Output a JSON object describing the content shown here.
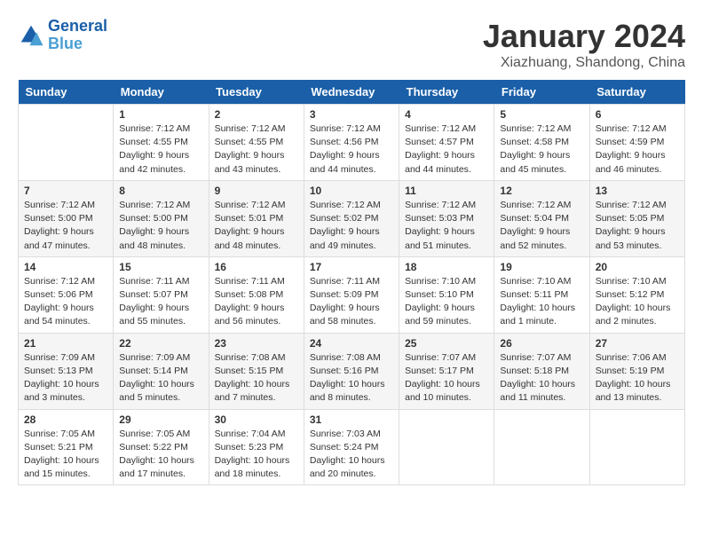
{
  "header": {
    "logo_general": "General",
    "logo_blue": "Blue",
    "month": "January 2024",
    "location": "Xiazhuang, Shandong, China"
  },
  "days_of_week": [
    "Sunday",
    "Monday",
    "Tuesday",
    "Wednesday",
    "Thursday",
    "Friday",
    "Saturday"
  ],
  "weeks": [
    [
      {
        "num": "",
        "info": ""
      },
      {
        "num": "1",
        "info": "Sunrise: 7:12 AM\nSunset: 4:55 PM\nDaylight: 9 hours\nand 42 minutes."
      },
      {
        "num": "2",
        "info": "Sunrise: 7:12 AM\nSunset: 4:55 PM\nDaylight: 9 hours\nand 43 minutes."
      },
      {
        "num": "3",
        "info": "Sunrise: 7:12 AM\nSunset: 4:56 PM\nDaylight: 9 hours\nand 44 minutes."
      },
      {
        "num": "4",
        "info": "Sunrise: 7:12 AM\nSunset: 4:57 PM\nDaylight: 9 hours\nand 44 minutes."
      },
      {
        "num": "5",
        "info": "Sunrise: 7:12 AM\nSunset: 4:58 PM\nDaylight: 9 hours\nand 45 minutes."
      },
      {
        "num": "6",
        "info": "Sunrise: 7:12 AM\nSunset: 4:59 PM\nDaylight: 9 hours\nand 46 minutes."
      }
    ],
    [
      {
        "num": "7",
        "info": "Sunrise: 7:12 AM\nSunset: 5:00 PM\nDaylight: 9 hours\nand 47 minutes."
      },
      {
        "num": "8",
        "info": "Sunrise: 7:12 AM\nSunset: 5:00 PM\nDaylight: 9 hours\nand 48 minutes."
      },
      {
        "num": "9",
        "info": "Sunrise: 7:12 AM\nSunset: 5:01 PM\nDaylight: 9 hours\nand 48 minutes."
      },
      {
        "num": "10",
        "info": "Sunrise: 7:12 AM\nSunset: 5:02 PM\nDaylight: 9 hours\nand 49 minutes."
      },
      {
        "num": "11",
        "info": "Sunrise: 7:12 AM\nSunset: 5:03 PM\nDaylight: 9 hours\nand 51 minutes."
      },
      {
        "num": "12",
        "info": "Sunrise: 7:12 AM\nSunset: 5:04 PM\nDaylight: 9 hours\nand 52 minutes."
      },
      {
        "num": "13",
        "info": "Sunrise: 7:12 AM\nSunset: 5:05 PM\nDaylight: 9 hours\nand 53 minutes."
      }
    ],
    [
      {
        "num": "14",
        "info": "Sunrise: 7:12 AM\nSunset: 5:06 PM\nDaylight: 9 hours\nand 54 minutes."
      },
      {
        "num": "15",
        "info": "Sunrise: 7:11 AM\nSunset: 5:07 PM\nDaylight: 9 hours\nand 55 minutes."
      },
      {
        "num": "16",
        "info": "Sunrise: 7:11 AM\nSunset: 5:08 PM\nDaylight: 9 hours\nand 56 minutes."
      },
      {
        "num": "17",
        "info": "Sunrise: 7:11 AM\nSunset: 5:09 PM\nDaylight: 9 hours\nand 58 minutes."
      },
      {
        "num": "18",
        "info": "Sunrise: 7:10 AM\nSunset: 5:10 PM\nDaylight: 9 hours\nand 59 minutes."
      },
      {
        "num": "19",
        "info": "Sunrise: 7:10 AM\nSunset: 5:11 PM\nDaylight: 10 hours\nand 1 minute."
      },
      {
        "num": "20",
        "info": "Sunrise: 7:10 AM\nSunset: 5:12 PM\nDaylight: 10 hours\nand 2 minutes."
      }
    ],
    [
      {
        "num": "21",
        "info": "Sunrise: 7:09 AM\nSunset: 5:13 PM\nDaylight: 10 hours\nand 3 minutes."
      },
      {
        "num": "22",
        "info": "Sunrise: 7:09 AM\nSunset: 5:14 PM\nDaylight: 10 hours\nand 5 minutes."
      },
      {
        "num": "23",
        "info": "Sunrise: 7:08 AM\nSunset: 5:15 PM\nDaylight: 10 hours\nand 7 minutes."
      },
      {
        "num": "24",
        "info": "Sunrise: 7:08 AM\nSunset: 5:16 PM\nDaylight: 10 hours\nand 8 minutes."
      },
      {
        "num": "25",
        "info": "Sunrise: 7:07 AM\nSunset: 5:17 PM\nDaylight: 10 hours\nand 10 minutes."
      },
      {
        "num": "26",
        "info": "Sunrise: 7:07 AM\nSunset: 5:18 PM\nDaylight: 10 hours\nand 11 minutes."
      },
      {
        "num": "27",
        "info": "Sunrise: 7:06 AM\nSunset: 5:19 PM\nDaylight: 10 hours\nand 13 minutes."
      }
    ],
    [
      {
        "num": "28",
        "info": "Sunrise: 7:05 AM\nSunset: 5:21 PM\nDaylight: 10 hours\nand 15 minutes."
      },
      {
        "num": "29",
        "info": "Sunrise: 7:05 AM\nSunset: 5:22 PM\nDaylight: 10 hours\nand 17 minutes."
      },
      {
        "num": "30",
        "info": "Sunrise: 7:04 AM\nSunset: 5:23 PM\nDaylight: 10 hours\nand 18 minutes."
      },
      {
        "num": "31",
        "info": "Sunrise: 7:03 AM\nSunset: 5:24 PM\nDaylight: 10 hours\nand 20 minutes."
      },
      {
        "num": "",
        "info": ""
      },
      {
        "num": "",
        "info": ""
      },
      {
        "num": "",
        "info": ""
      }
    ]
  ]
}
